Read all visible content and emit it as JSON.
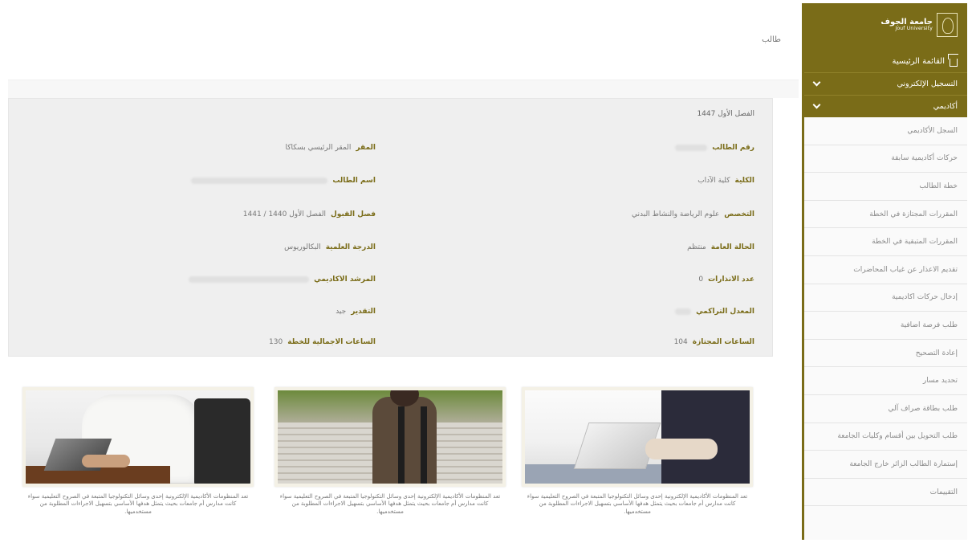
{
  "breadcrumb": "طالب",
  "sidebar": {
    "logo_ar": "جامعة الجوف",
    "logo_en": "Jouf University",
    "home": "القائمة الرئيسية",
    "sections": [
      {
        "label": "التسجيل الإلكتروني"
      },
      {
        "label": "أكاديمي"
      }
    ],
    "items": [
      {
        "label": "السجل الأكاديمي"
      },
      {
        "label": "حركات أكاديمية سابقة"
      },
      {
        "label": "خطة الطالب"
      },
      {
        "label": "المقررات المجتازة في الخطة"
      },
      {
        "label": "المقررات المتبقية في الخطة"
      },
      {
        "label": "تقديم الاعذار عن غياب المحاضرات"
      },
      {
        "label": "إدخال حركات اكاديمية"
      },
      {
        "label": "طلب فرصة اضافية"
      },
      {
        "label": "إعادة التصحيح"
      },
      {
        "label": "تحديد مسار"
      },
      {
        "label": "طلب بطاقة صراف آلي"
      },
      {
        "label": "طلب التحويل بين أقسام وكليات الجامعة"
      },
      {
        "label": "إستمارة الطالب الزائر خارج الجامعة"
      },
      {
        "label": "التقييمات"
      }
    ]
  },
  "student": {
    "term": "الفصل الأول 1447",
    "right": {
      "student_no_label": "رقم الطالب",
      "college_label": "الكلية",
      "college": "كلية الآداب",
      "major_label": "التخصص",
      "major": "علوم الرياضة والنشاط البدني",
      "status_label": "الحالة العامة",
      "status": "منتظم",
      "warnings_label": "عدد الانذارات",
      "warnings": "0",
      "gpa_label": "المعدل التراكمي",
      "passed_hours_label": "الساعات المجتازة",
      "passed_hours": "104"
    },
    "left": {
      "campus_label": "المقر",
      "campus": "المقر الرئيسي بسكاكا",
      "name_label": "اسم الطالب",
      "admission_label": "فصل القبول",
      "admission": "الفصل الأول 1440 / 1441",
      "degree_label": "الدرجة العلمية",
      "degree": "البكالوريوس",
      "advisor_label": "المرشد الاكاديمي",
      "grade_label": "التقدير",
      "grade": "جيد",
      "total_hours_label": "الساعات الاجمالية للخطة",
      "total_hours": "130"
    }
  },
  "cards": [
    {
      "caption": "تعد المنظومات الأكاديمية الإلكترونية إحدى وسائل التكنولوجيا المتبعة في الصروح التعليمية سواء كانت مدارس أم جامعات بحيث يتمثل هدفها الأساسي بتسهيل الاجراءات المطلوبة من مستخدميها."
    },
    {
      "caption": "تعد المنظومات الأكاديمية الإلكترونية إحدى وسائل التكنولوجيا المتبعة في الصروح التعليمية سواء كانت مدارس أم جامعات بحيث يتمثل هدفها الأساسي بتسهيل الاجراءات المطلوبة من مستخدميها."
    },
    {
      "caption": "تعد المنظومات الأكاديمية الإلكترونية إحدى وسائل التكنولوجيا المتبعة في الصروح التعليمية سواء كانت مدارس أم جامعات بحيث يتمثل هدفها الأساسي بتسهيل الاجراءات المطلوبة من مستخدميها."
    }
  ],
  "colors": {
    "brand": "#7a6c18",
    "panel_bg": "#efefef"
  }
}
